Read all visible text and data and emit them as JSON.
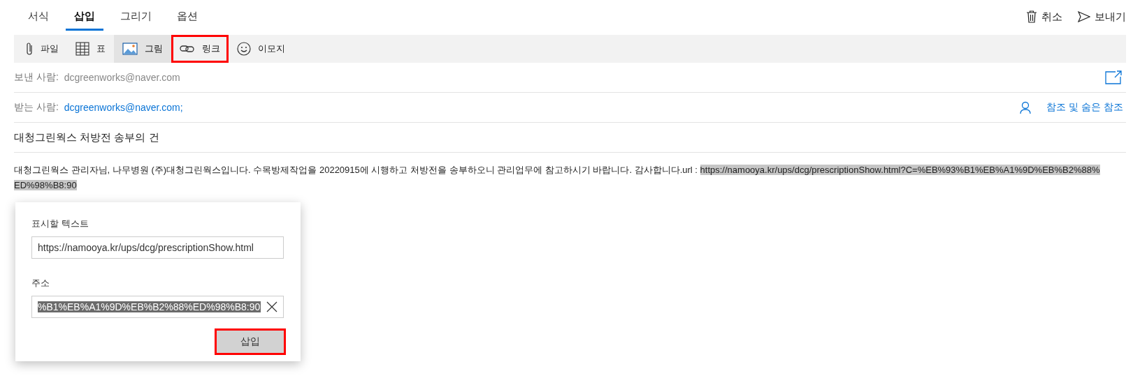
{
  "tabs": [
    {
      "label": "서식",
      "selected": false
    },
    {
      "label": "삽입",
      "selected": true
    },
    {
      "label": "그리기",
      "selected": false
    },
    {
      "label": "옵션",
      "selected": false
    }
  ],
  "actions": [
    {
      "kind": "discard",
      "label": "취소"
    },
    {
      "kind": "send",
      "label": "보내기"
    }
  ],
  "toolbar": [
    {
      "kind": "file",
      "label": "파일",
      "active": false,
      "highlighted": false
    },
    {
      "kind": "table",
      "label": "표",
      "active": false,
      "highlighted": false
    },
    {
      "kind": "picture",
      "label": "그림",
      "active": true,
      "highlighted": false
    },
    {
      "kind": "link",
      "label": "링크",
      "active": false,
      "highlighted": true
    },
    {
      "kind": "emoji",
      "label": "이모지",
      "active": false,
      "highlighted": false
    }
  ],
  "from": {
    "label": "보낸 사람:",
    "value": "dcgreenworks@naver.com"
  },
  "to": {
    "label": "받는 사람:",
    "value": "dcgreenworks@naver.com;",
    "cc_link": "참조 및 숨은 참조"
  },
  "subject": "대청그린웍스 처방전 송부의 건",
  "body": {
    "text": "대청그린웍스 관리자님, 나무병원 (주)대청그린웍스입니다. 수목방제작업을 20220915에 시행하고 처방전을 송부하오니 관리업무에 참고하시기 바랍니다. 감사합니다.url : ",
    "selected_link_lines": [
      "https://namooya.kr/ups/dcg/prescriptionShow.html?C=%EB%93%B1%EB%A1%9D%EB%B2%88%",
      "ED%98%B8:90"
    ]
  },
  "link_dialog": {
    "display_text_label": "표시할 텍스트",
    "display_text": "https://namooya.kr/ups/dcg/prescriptionShow.html",
    "address_label": "주소",
    "address": "%B1%EB%A1%9D%EB%B2%88%ED%98%B8:90",
    "insert_button": {
      "label": "삽입",
      "highlighted": true
    }
  }
}
